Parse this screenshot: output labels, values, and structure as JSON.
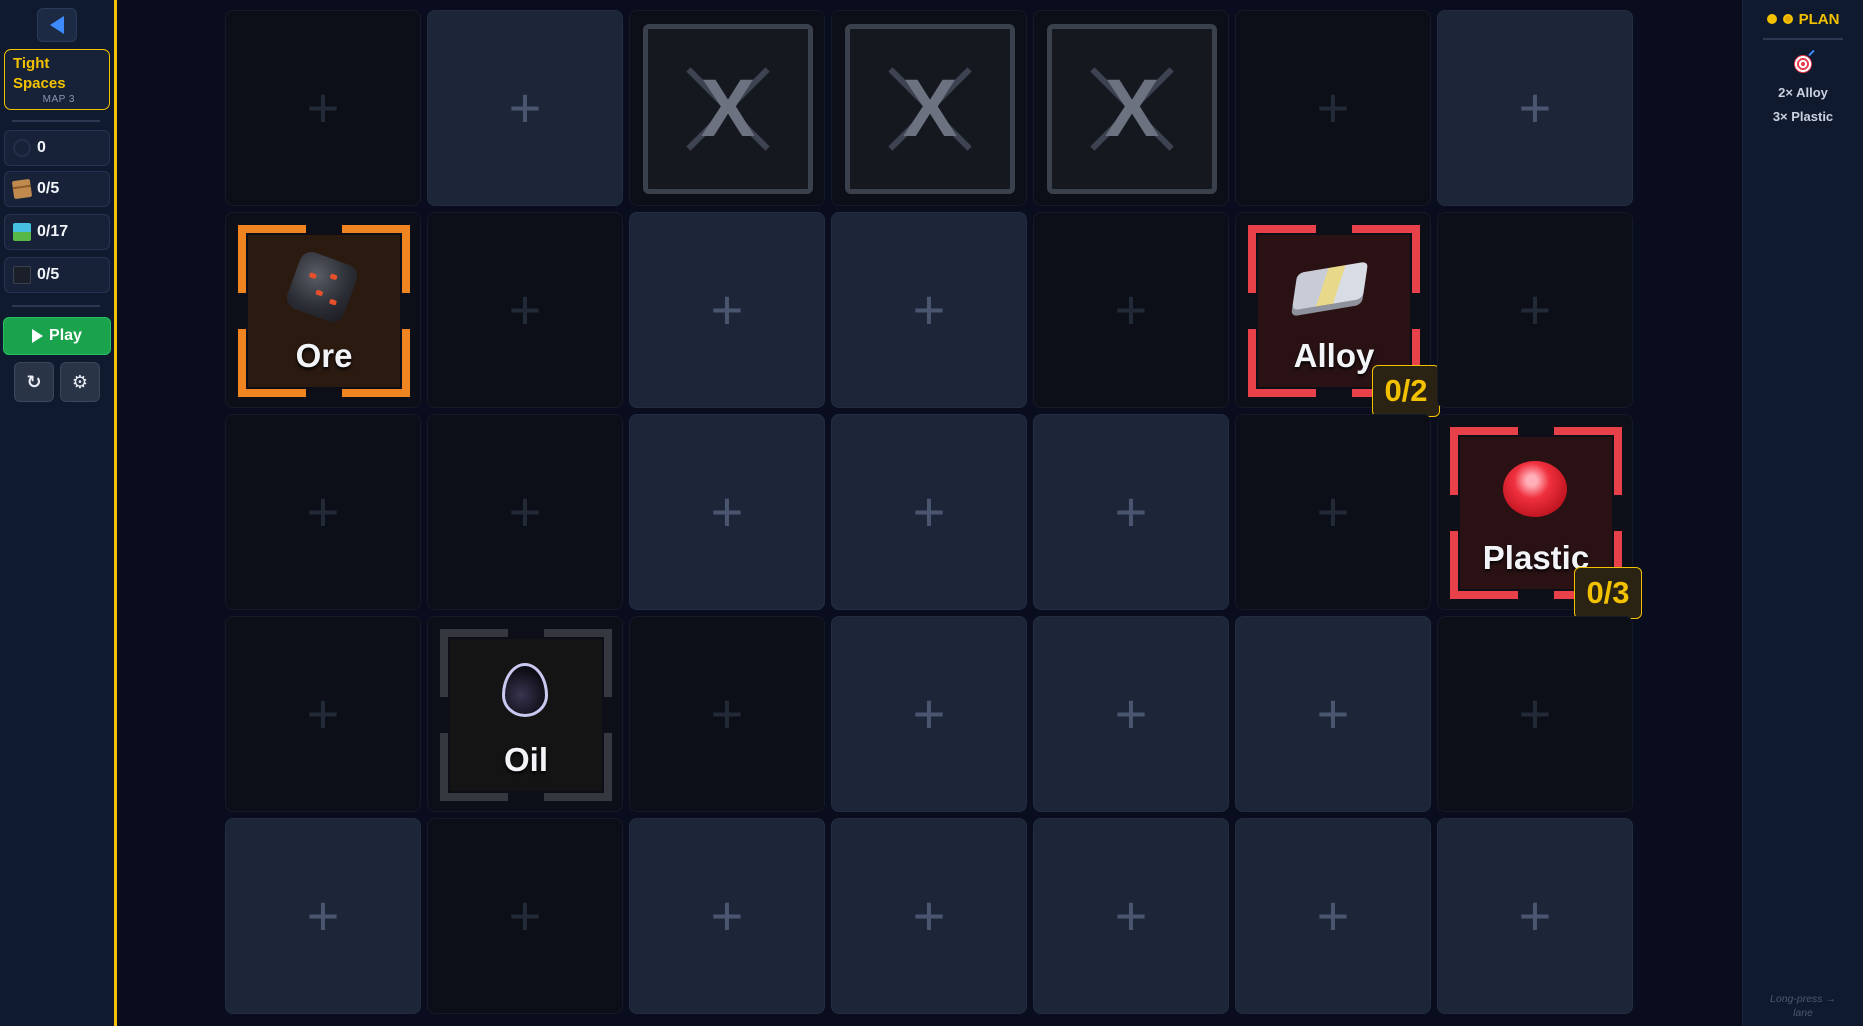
{
  "sidebar": {
    "back_icon": "back-arrow-icon",
    "level": {
      "name": "Tight Spaces",
      "map": "MAP 3"
    },
    "stats": [
      {
        "icon": "timer-icon",
        "value": "0"
      },
      {
        "icon": "box-icon",
        "value": "0/5"
      },
      {
        "icon": "landscape-icon",
        "value": "0/17"
      },
      {
        "icon": "briefcase-icon",
        "value": "0/5"
      }
    ],
    "play_label": "Play",
    "reset_icon": "↻",
    "settings_icon": "⚙"
  },
  "plan": {
    "title": "PLAN",
    "goals": [
      "2× Alloy",
      "3× Plastic"
    ],
    "hint": "Long-press → lane"
  },
  "board": {
    "plus_glyph": "+",
    "blocked_glyph": "X",
    "tiles": {
      "ore": {
        "label": "Ore"
      },
      "alloy": {
        "label": "Alloy",
        "progress": "0/2"
      },
      "plastic": {
        "label": "Plastic",
        "progress": "0/3"
      },
      "oil": {
        "label": "Oil"
      }
    }
  },
  "colors": {
    "accent": "#f2c200",
    "source_ore": "#f08420",
    "target": "#e8414a",
    "play": "#1aa24d"
  }
}
